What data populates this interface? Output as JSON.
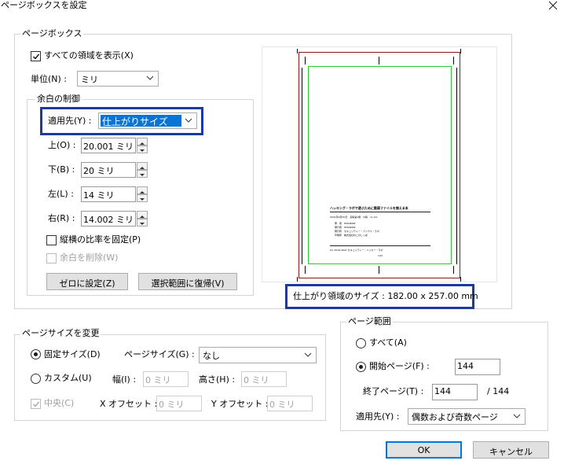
{
  "window": {
    "title": "ページボックスを設定"
  },
  "page_box": {
    "legend": "ページボックス",
    "show_all_label": "すべての領域を表示(X)",
    "unit_label": "単位(N) :",
    "unit_value": "ミリ"
  },
  "margins": {
    "legend": "余白の制御",
    "apply_to_label": "適用先(Y) :",
    "apply_to_value": "仕上がりサイズ",
    "top_label": "上(O) :",
    "top_value": "20.001 ミリ",
    "bottom_label": "下(B) :",
    "bottom_value": "20 ミリ",
    "left_label": "左(L) :",
    "left_value": "14 ミリ",
    "right_label": "右(R) :",
    "right_value": "14.002 ミリ",
    "constrain_label": "縦横の比率を固定(P)",
    "remove_white_label": "余白を削除(W)",
    "zero_button": "ゼロに設定(Z)",
    "revert_button": "選択範囲に復帰(V)"
  },
  "preview": {
    "doc_title": "ハッキング・ラボで遊ぶために脆弱ファイルを揃える本",
    "doc_date": "2021年9月30日　初版第1刷　IS版　v1.0.0",
    "doc_lines": [
      "著　者　IPUSIRON",
      "発行者　IPUSIRON",
      "発行所　セキュリティー・ブックス・ラボ",
      "印刷所　株式会社ねこのしっぽ"
    ],
    "doc_copyright": "(C) 2016-2021 セキュリティー・ハッカー・ラボ",
    "doc_page": "144",
    "size_label": "仕上がり領域のサイズ : 182.00 x 257.00 mm"
  },
  "page_size": {
    "legend": "ページサイズを変更",
    "fixed_label": "固定サイズ(D)",
    "page_size_label": "ページサイズ(G) :",
    "page_size_value": "なし",
    "custom_label": "カスタム(U)",
    "width_label": "幅(I) :",
    "width_value": "0 ミリ",
    "height_label": "高さ(H) :",
    "height_value": "0 ミリ",
    "center_label": "中央(C)",
    "xoffset_label": "X オフセット :",
    "xoffset_value": "0 ミリ",
    "yoffset_label": "Y オフセット :",
    "yoffset_value": "0 ミリ"
  },
  "page_range": {
    "legend": "ページ範囲",
    "all_label": "すべて(A)",
    "start_label": "開始ページ(F) :",
    "start_value": "144",
    "end_label": "終了ページ(T) :",
    "end_value": "144",
    "total_label": "/ 144",
    "apply_label": "適用先(Y) :",
    "apply_value": "偶数および奇数ページ"
  },
  "buttons": {
    "ok": "OK",
    "cancel": "キャンセル"
  },
  "colors": {
    "highlight_box": "#1a3aa0",
    "selection": "#0a74d6",
    "trim_box": "#8b1a1a",
    "bleed_box": "#2ec82e"
  }
}
